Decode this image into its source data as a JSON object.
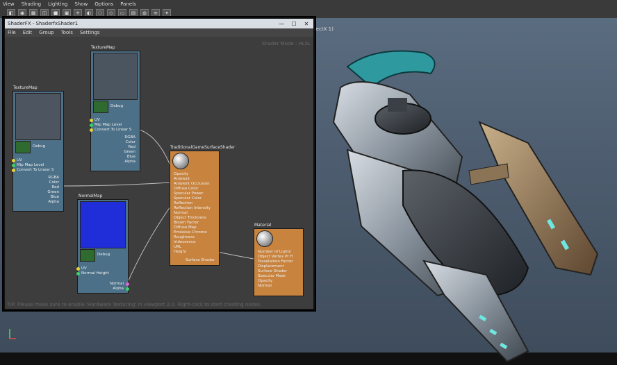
{
  "app": {
    "menu": [
      "View",
      "Shading",
      "Lighting",
      "Show",
      "Options",
      "Panels"
    ],
    "viewport_label": "(ectX 1)"
  },
  "shaderfx": {
    "title": "ShaderFX - ShaderfxShader1",
    "menu": [
      "File",
      "Edit",
      "Group",
      "Tools",
      "Settings"
    ],
    "shader_mode": "Shader Mode : HLSL",
    "status": "TIP: Please make sure to enable 'Hardware Texturing' in viewport 2.0. Right-click to start creating nodes.",
    "nodes": {
      "texmap1": {
        "title": "TextureMap",
        "inputs": [
          "UV",
          "Mip Map Level",
          "Convert To Linear S"
        ],
        "outputs": [
          "RGBA",
          "Color",
          "Red",
          "Green",
          "Blue",
          "Alpha"
        ],
        "dbg": "Debug"
      },
      "texmap2": {
        "title": "TextureMap",
        "inputs": [
          "UV",
          "Mip Map Level",
          "Convert To Linear S"
        ],
        "outputs": [
          "RGBA",
          "Color",
          "Red",
          "Green",
          "Blue",
          "Alpha"
        ],
        "dbg": "Debug"
      },
      "normalmap": {
        "title": "NormalMap",
        "inputs": [
          "UV",
          "Normal Height"
        ],
        "outputs": [
          "Normal",
          "Alpha"
        ],
        "dbg": "Debug"
      },
      "surface": {
        "title": "TraditionalGameSurfaceShader",
        "inputs": [
          "Opacity",
          "Ambient",
          "Ambient Occlusion",
          "Diffuse Color",
          "Specular Power",
          "Specular Color",
          "Reflection",
          "Reflection Intensity",
          "Normal",
          "Object Thickness",
          "Bloom Factor",
          "Diffuse Map",
          "Emissive Chrome",
          "Roughness",
          "Iridescence",
          "URL",
          "Height"
        ],
        "output": "Surface Shader"
      },
      "material": {
        "title": "Material",
        "inputs": [
          "Number of Lights",
          "Object Vertex Pr H",
          "Tessellation Factor",
          "Displacement",
          "Surface Shader",
          "Specular Mask",
          "Opacity",
          "Normal"
        ]
      }
    }
  }
}
